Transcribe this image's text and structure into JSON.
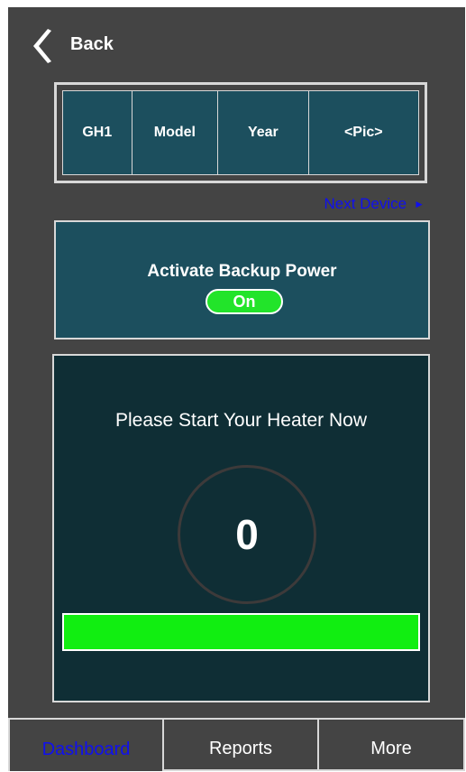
{
  "header": {
    "back_label": "Back",
    "back_icon": "chevron-left-icon"
  },
  "device": {
    "columns": [
      "GH1",
      "Model",
      "Year",
      "<Pic>"
    ],
    "next_label": "Next Device",
    "next_icon": "play-right-icon"
  },
  "backup": {
    "title": "Activate Backup Power",
    "toggle_label": "On"
  },
  "heater": {
    "message": "Please Start Your Heater Now",
    "value": "0",
    "progress_fraction": 1.0
  },
  "nav": {
    "tabs": [
      {
        "label": "Dashboard",
        "active": true
      },
      {
        "label": "Reports",
        "active": false
      },
      {
        "label": "More",
        "active": false
      }
    ]
  },
  "colors": {
    "background": "#444444",
    "panel": "#1c4f5e",
    "heater_panel": "#0f2e35",
    "accent_green": "#11ee11",
    "link_blue": "#1010ee"
  }
}
